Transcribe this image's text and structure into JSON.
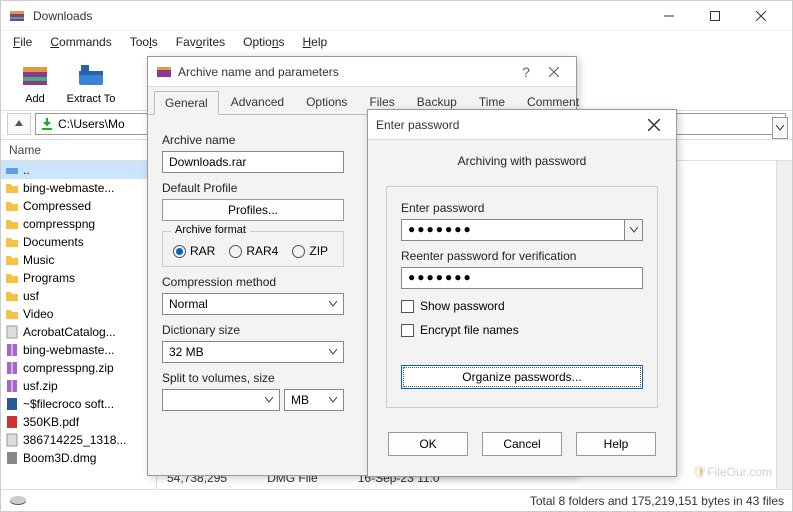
{
  "titlebar": {
    "title": "Downloads"
  },
  "menubar": {
    "file": "File",
    "commands": "Commands",
    "tools": "Tools",
    "favorites": "Favorites",
    "options": "Options",
    "help": "Help"
  },
  "toolbar": {
    "add": "Add",
    "extract": "Extract To"
  },
  "addressbar": {
    "path": "C:\\Users\\Mo"
  },
  "columns": {
    "name": "Name"
  },
  "files": {
    "up": "..",
    "items": [
      "bing-webmaste...",
      "Compressed",
      "compresspng",
      "Documents",
      "Music",
      "Programs",
      "usf",
      "Video",
      "AcrobatCatalog...",
      "bing-webmaste...",
      "compresspng.zip",
      "usf.zip",
      "~$filecroco soft...",
      "350KB.pdf",
      "386714225_1318...",
      "Boom3D.dmg"
    ],
    "detail_row": {
      "size": "54,738,295",
      "type": "DMG File",
      "date": "16-Sep-23 11:0"
    }
  },
  "statusbar": {
    "text": "Total 8 folders and 175,219,151 bytes in 43 files"
  },
  "archive_dialog": {
    "title": "Archive name and parameters",
    "tabs": {
      "general": "General",
      "advanced": "Advanced",
      "options": "Options",
      "files": "Files",
      "backup": "Backup",
      "time": "Time",
      "comment": "Comment"
    },
    "archive_name_label": "Archive name",
    "archive_name_value": "Downloads.rar",
    "default_profile_label": "Default Profile",
    "profiles_btn": "Profiles...",
    "archive_format_label": "Archive format",
    "formats": {
      "rar": "RAR",
      "rar4": "RAR4",
      "zip": "ZIP"
    },
    "compression_label": "Compression method",
    "compression_value": "Normal",
    "dictionary_label": "Dictionary size",
    "dictionary_value": "32 MB",
    "split_label": "Split to volumes, size",
    "split_unit": "MB"
  },
  "password_dialog": {
    "title": "Enter password",
    "heading": "Archiving with password",
    "enter_label": "Enter password",
    "enter_value": "●●●●●●●",
    "reenter_label": "Reenter password for verification",
    "reenter_value": "●●●●●●●",
    "show_password": "Show password",
    "encrypt_names": "Encrypt file names",
    "organize_btn": "Organize passwords...",
    "ok": "OK",
    "cancel": "Cancel",
    "help": "Help"
  },
  "watermark": "FileOur.com"
}
